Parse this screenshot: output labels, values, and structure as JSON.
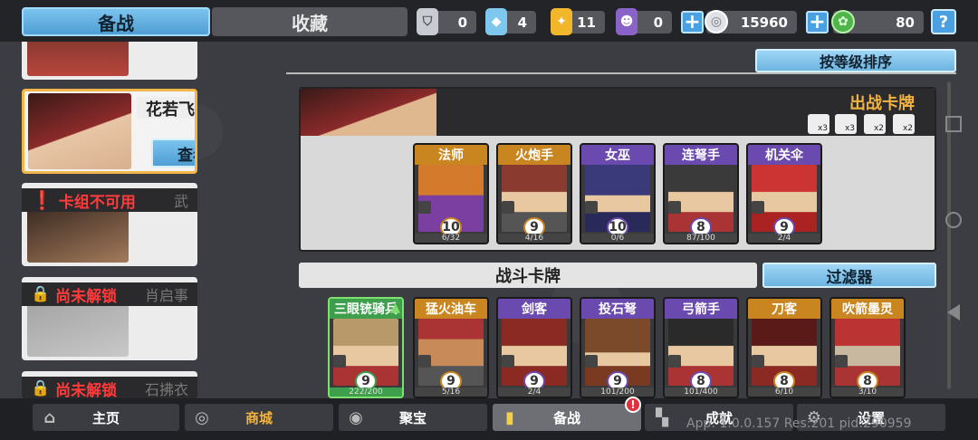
{
  "tabs": {
    "deploy": "备战",
    "collection": "收藏"
  },
  "resources": [
    {
      "icon": "silver-shield-icon",
      "value": "0",
      "color": "#c8ccd2"
    },
    {
      "icon": "blue-crystal-icon",
      "value": "4",
      "color": "#7ec8f0"
    },
    {
      "icon": "gold-badge-icon",
      "value": "11",
      "color": "#f2b62b"
    },
    {
      "icon": "purple-mask-icon",
      "value": "0",
      "color": "#8a63c8"
    }
  ],
  "currency": {
    "silver_coin": "15960",
    "green_gem": "80"
  },
  "help_label": "?",
  "heroes": [
    {
      "name": "花若飞",
      "detail_button": "查看详情",
      "selected": true
    },
    {
      "status": "卡组不可用",
      "name": "武"
    },
    {
      "status": "尚未解锁",
      "name": "肖启事"
    },
    {
      "status": "尚未解锁",
      "name": "石拂衣"
    }
  ],
  "sort_button": "按等级排序",
  "deck": {
    "title": "出战卡牌",
    "multipliers": [
      "x3",
      "x3",
      "x2",
      "x2"
    ],
    "cards": [
      {
        "name": "法师",
        "level": "10",
        "progress": "6/32",
        "rarity": "orange"
      },
      {
        "name": "火炮手",
        "level": "9",
        "progress": "4/16",
        "rarity": "orange"
      },
      {
        "name": "女巫",
        "level": "10",
        "progress": "0/6",
        "rarity": "purple"
      },
      {
        "name": "连弩手",
        "level": "8",
        "progress": "87/100",
        "rarity": "purple"
      },
      {
        "name": "机关伞",
        "level": "9",
        "progress": "2/4",
        "rarity": "purple"
      }
    ]
  },
  "battle": {
    "title": "战斗卡牌",
    "filter_button": "过滤器",
    "cards": [
      {
        "name": "三眼铳骑兵",
        "level": "9",
        "progress": "222/200",
        "rarity": "green"
      },
      {
        "name": "猛火油车",
        "level": "9",
        "progress": "5/16",
        "rarity": "orange"
      },
      {
        "name": "剑客",
        "level": "9",
        "progress": "2/4",
        "rarity": "purple"
      },
      {
        "name": "投石弩",
        "level": "9",
        "progress": "101/200",
        "rarity": "purple"
      },
      {
        "name": "弓箭手",
        "level": "8",
        "progress": "101/400",
        "rarity": "purple"
      },
      {
        "name": "刀客",
        "level": "8",
        "progress": "6/10",
        "rarity": "orange"
      },
      {
        "name": "吹箭墨灵",
        "level": "8",
        "progress": "3/10",
        "rarity": "orange"
      }
    ]
  },
  "nav": {
    "home": "主页",
    "shop": "商城",
    "treasure": "聚宝",
    "deploy": "备战",
    "achievements": "成就",
    "settings": "设置",
    "badge": "!"
  },
  "debug_text": "App: 1.0.0.157 Res:201 pid:290959"
}
